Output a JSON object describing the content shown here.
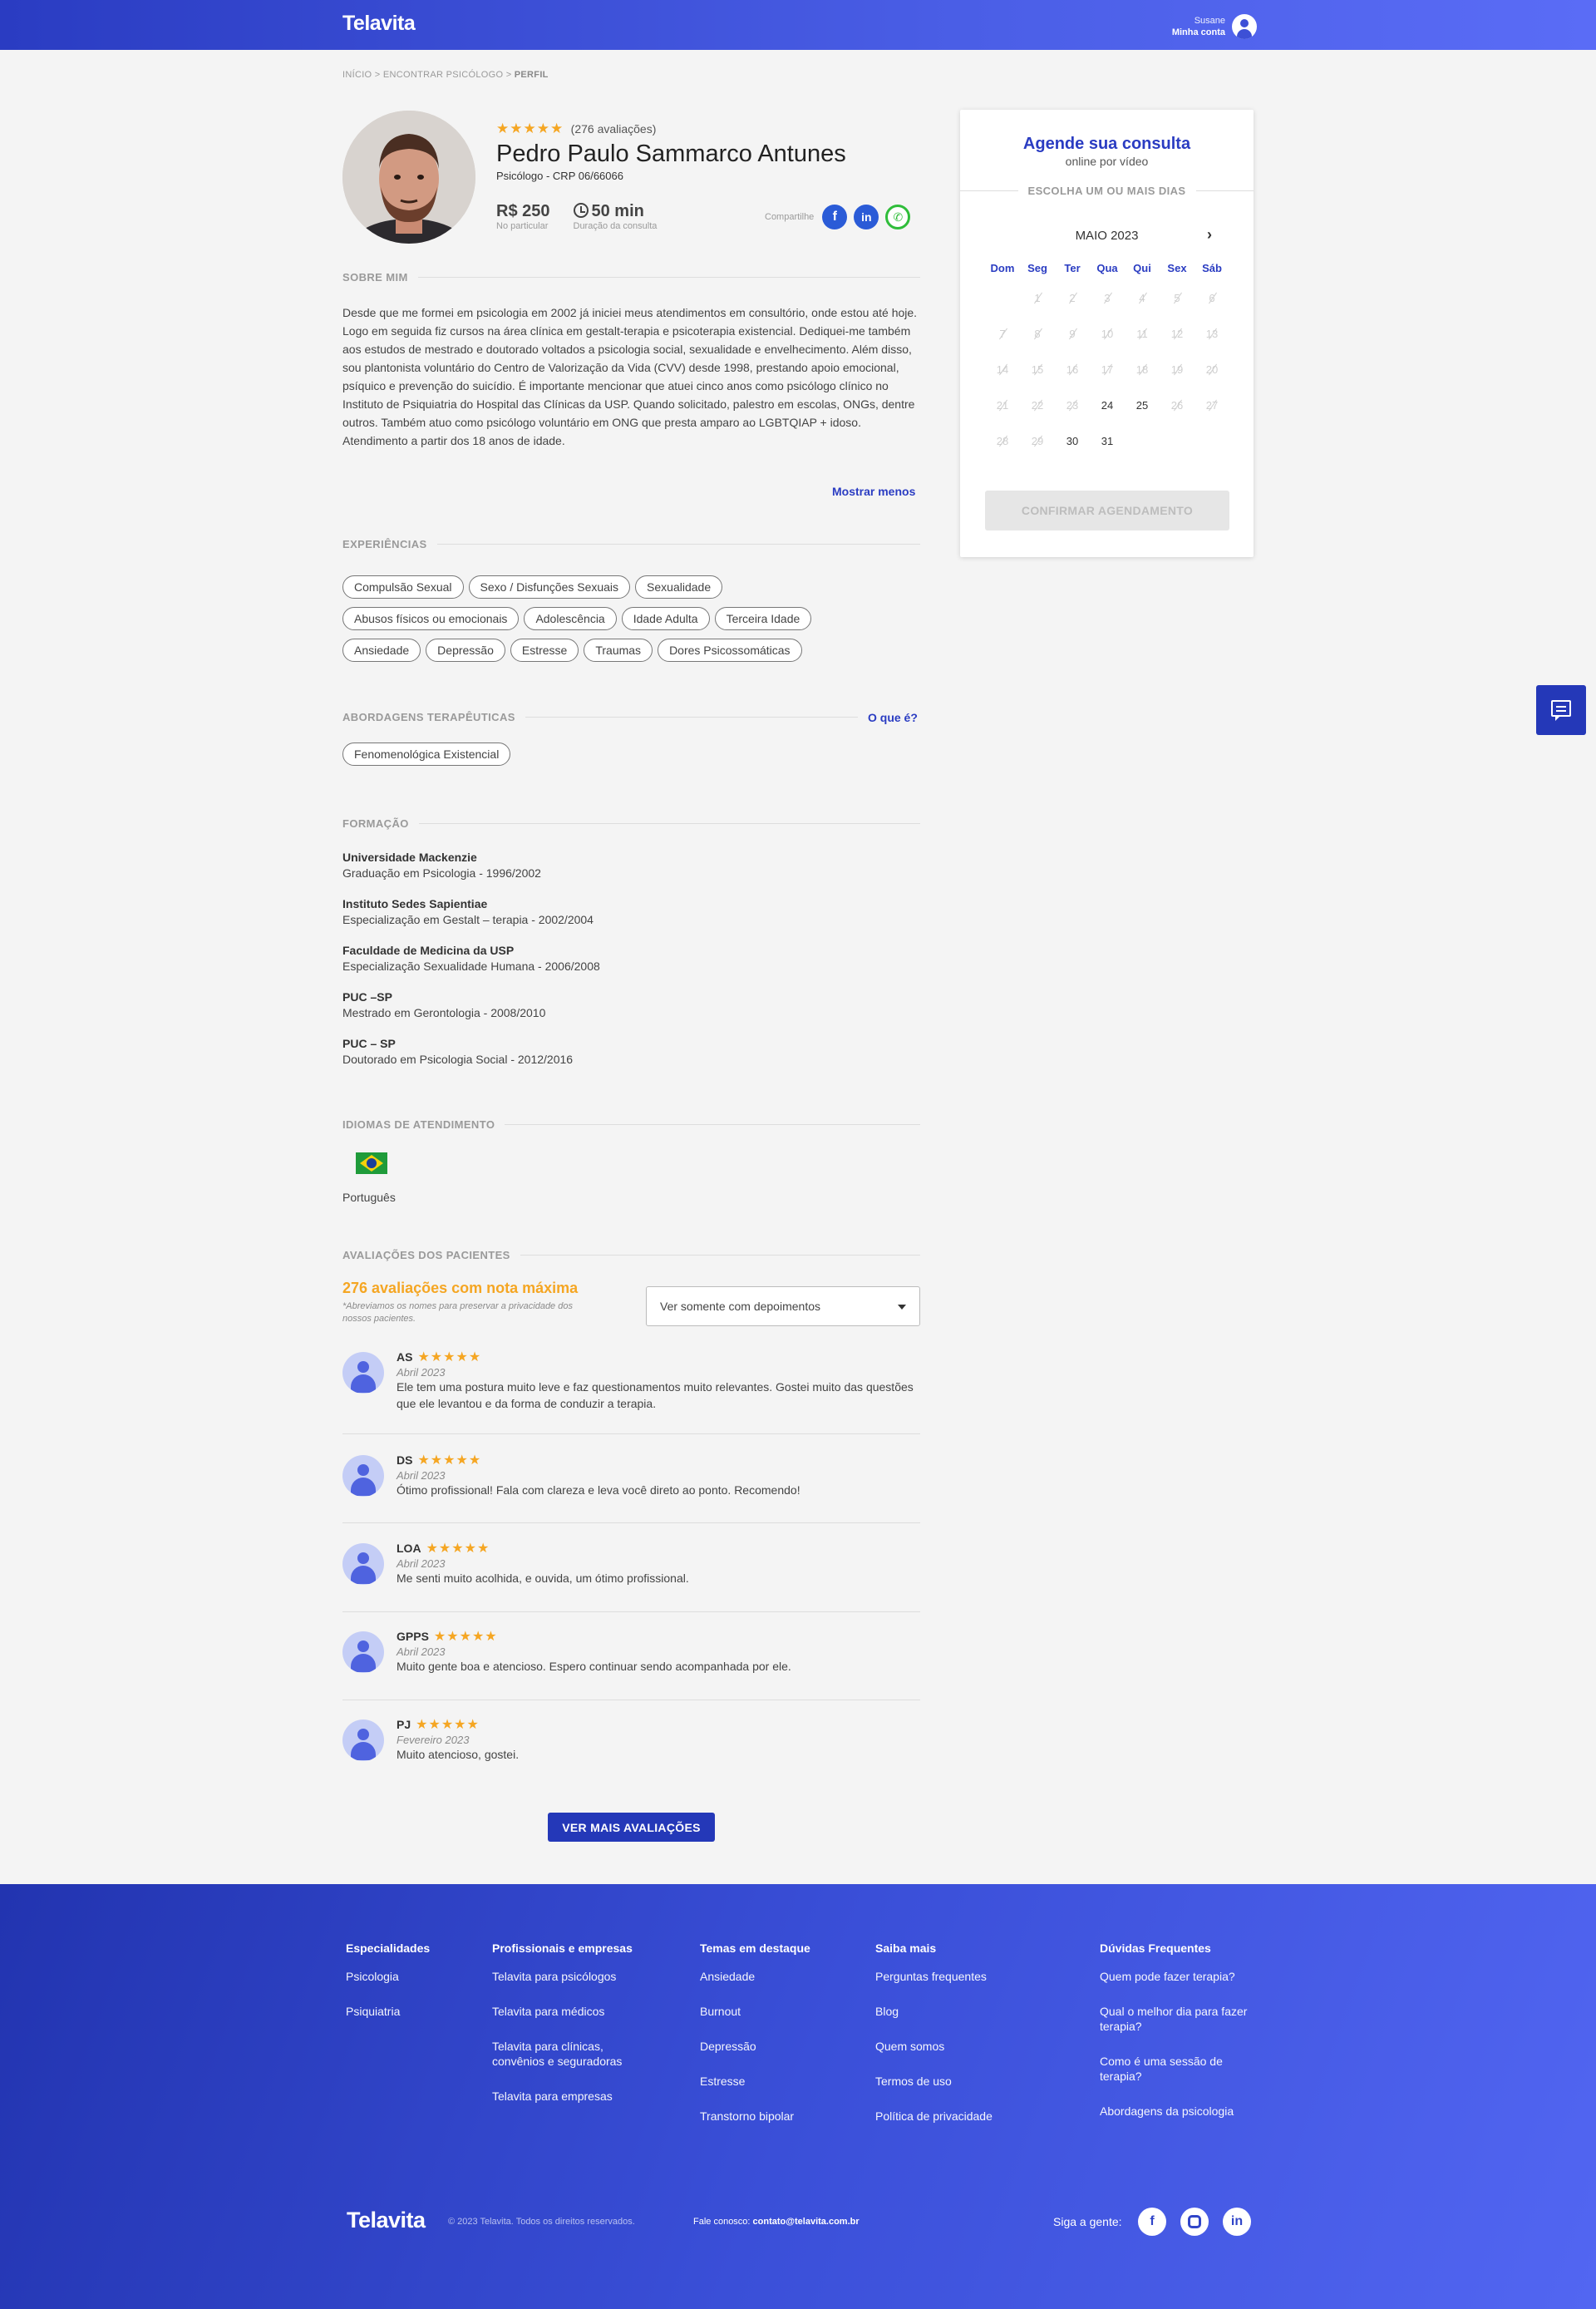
{
  "header": {
    "logo": "Telavita",
    "user_name": "Susane",
    "account_label": "Minha conta"
  },
  "breadcrumb": {
    "items": [
      "INÍCIO",
      "ENCONTRAR PSICÓLOGO"
    ],
    "current": "PERFIL",
    "separator": ">"
  },
  "profile": {
    "stars": "★★★★★",
    "rating": 5,
    "reviews_count": "(276 avaliações)",
    "name": "Pedro Paulo Sammarco Antunes",
    "crp": "Psicólogo - CRP 06/66066",
    "price": "R$ 250",
    "price_label": "No particular",
    "duration": "50 min",
    "duration_label": "Duração da consulta",
    "share_label": "Compartilhe"
  },
  "about": {
    "title": "SOBRE MIM",
    "text": "Desde que me formei em psicologia em 2002 já iniciei meus atendimentos em consultório, onde estou até hoje. Logo em seguida fiz cursos na área clínica em gestalt-terapia e psicoterapia existencial. Dediquei-me também aos estudos de mestrado e doutorado voltados a psicologia social, sexualidade e envelhecimento. Além disso, sou plantonista voluntário do Centro de Valorização da Vida (CVV) desde 1998, prestando apoio emocional, psíquico e prevenção do suicídio. É importante mencionar que atuei cinco anos como psicólogo clínico no Instituto de Psiquiatria do Hospital das Clínicas da USP. Quando solicitado, palestro em escolas, ONGs, dentre outros. Também atuo como psicólogo voluntário em ONG que presta amparo ao LGBTQIAP + idoso. Atendimento a partir dos 18 anos de idade.",
    "toggle": "Mostrar menos"
  },
  "experiences": {
    "title": "EXPERIÊNCIAS",
    "tags": [
      "Compulsão Sexual",
      "Sexo / Disfunções Sexuais",
      "Sexualidade",
      "Abusos físicos ou emocionais",
      "Adolescência",
      "Idade Adulta",
      "Terceira Idade",
      "Ansiedade",
      "Depressão",
      "Estresse",
      "Traumas",
      "Dores Psicossomáticas"
    ]
  },
  "approaches": {
    "title": "ABORDAGENS TERAPÊUTICAS",
    "link": "O que é?",
    "tags": [
      "Fenomenológica Existencial"
    ]
  },
  "education": {
    "title": "FORMAÇÃO",
    "items": [
      {
        "school": "Universidade Mackenzie",
        "detail": "Graduação em Psicologia - 1996/2002"
      },
      {
        "school": "Instituto Sedes Sapientiae",
        "detail": "Especialização em Gestalt – terapia - 2002/2004"
      },
      {
        "school": "Faculdade de Medicina da USP",
        "detail": "Especialização Sexualidade Humana - 2006/2008"
      },
      {
        "school": "PUC –SP",
        "detail": "Mestrado em Gerontologia - 2008/2010"
      },
      {
        "school": "PUC – SP",
        "detail": "Doutorado em Psicologia Social - 2012/2016"
      }
    ]
  },
  "languages": {
    "title": "IDIOMAS DE ATENDIMENTO",
    "items": [
      "Português"
    ]
  },
  "reviews": {
    "title": "AVALIAÇÕES DOS PACIENTES",
    "summary": "276 avaliações com nota máxima",
    "disclaimer": "*Abreviamos os nomes para preservar a privacidade dos nossos pacientes.",
    "filter": "Ver somente com depoimentos",
    "items": [
      {
        "name": "AS",
        "stars": "★★★★★",
        "date": "Abril 2023",
        "text": "Ele tem uma postura muito leve e faz questionamentos muito relevantes. Gostei muito das questões que ele levantou e da forma de conduzir a terapia."
      },
      {
        "name": "DS",
        "stars": "★★★★★",
        "date": "Abril 2023",
        "text": "Ótimo profissional! Fala com clareza e leva você direto ao ponto. Recomendo!"
      },
      {
        "name": "LOA",
        "stars": "★★★★★",
        "date": "Abril 2023",
        "text": "Me senti muito acolhida, e ouvida, um ótimo profissional."
      },
      {
        "name": "GPPS",
        "stars": "★★★★★",
        "date": "Abril 2023",
        "text": "Muito gente boa e atencioso. Espero continuar sendo acompanhada por ele."
      },
      {
        "name": "PJ",
        "stars": "★★★★★",
        "date": "Fevereiro 2023",
        "text": "Muito atencioso, gostei."
      }
    ],
    "more_button": "VER MAIS AVALIAÇÕES"
  },
  "booking": {
    "title": "Agende sua consulta",
    "subtitle": "online por vídeo",
    "divider": "ESCOLHA UM OU MAIS DIAS",
    "month": "MAIO 2023",
    "weekdays": [
      "Dom",
      "Seg",
      "Ter",
      "Qua",
      "Qui",
      "Sex",
      "Sáb"
    ],
    "weeks": [
      [
        {
          "d": "",
          "a": false
        },
        {
          "d": "1",
          "a": false
        },
        {
          "d": "2",
          "a": false
        },
        {
          "d": "3",
          "a": false
        },
        {
          "d": "4",
          "a": false
        },
        {
          "d": "5",
          "a": false
        },
        {
          "d": "6",
          "a": false
        }
      ],
      [
        {
          "d": "7",
          "a": false
        },
        {
          "d": "8",
          "a": false
        },
        {
          "d": "9",
          "a": false
        },
        {
          "d": "10",
          "a": false
        },
        {
          "d": "11",
          "a": false
        },
        {
          "d": "12",
          "a": false
        },
        {
          "d": "13",
          "a": false
        }
      ],
      [
        {
          "d": "14",
          "a": false
        },
        {
          "d": "15",
          "a": false
        },
        {
          "d": "16",
          "a": false
        },
        {
          "d": "17",
          "a": false
        },
        {
          "d": "18",
          "a": false
        },
        {
          "d": "19",
          "a": false
        },
        {
          "d": "20",
          "a": false
        }
      ],
      [
        {
          "d": "21",
          "a": false
        },
        {
          "d": "22",
          "a": false
        },
        {
          "d": "23",
          "a": false
        },
        {
          "d": "24",
          "a": true
        },
        {
          "d": "25",
          "a": true
        },
        {
          "d": "26",
          "a": false
        },
        {
          "d": "27",
          "a": false
        }
      ],
      [
        {
          "d": "28",
          "a": false
        },
        {
          "d": "29",
          "a": false
        },
        {
          "d": "30",
          "a": true
        },
        {
          "d": "31",
          "a": true
        },
        {
          "d": "",
          "a": false
        },
        {
          "d": "",
          "a": false
        },
        {
          "d": "",
          "a": false
        }
      ]
    ],
    "confirm": "CONFIRMAR AGENDAMENTO"
  },
  "footer": {
    "columns": [
      {
        "title": "Especialidades",
        "links": [
          "Psicologia",
          "Psiquiatria"
        ]
      },
      {
        "title": "Profissionais e empresas",
        "links": [
          "Telavita para psicólogos",
          "Telavita para médicos",
          "Telavita para clínicas, convênios e seguradoras",
          "Telavita para empresas"
        ]
      },
      {
        "title": "Temas em destaque",
        "links": [
          "Ansiedade",
          "Burnout",
          "Depressão",
          "Estresse",
          "Transtorno bipolar"
        ]
      },
      {
        "title": "Saiba mais",
        "links": [
          "Perguntas frequentes",
          "Blog",
          "Quem somos",
          "Termos de uso",
          "Política de privacidade"
        ]
      },
      {
        "title": "Dúvidas Frequentes",
        "links": [
          "Quem pode fazer terapia?",
          "Qual o melhor dia para fazer terapia?",
          "Como é uma sessão de terapia?",
          "Abordagens da psicologia"
        ]
      }
    ],
    "logo": "Telavita",
    "copyright": "© 2023 Telavita. Todos os direitos reservados.",
    "contact_label": "Fale conosco:",
    "contact_email": "contato@telavita.com.br",
    "follow": "Siga a gente:"
  }
}
